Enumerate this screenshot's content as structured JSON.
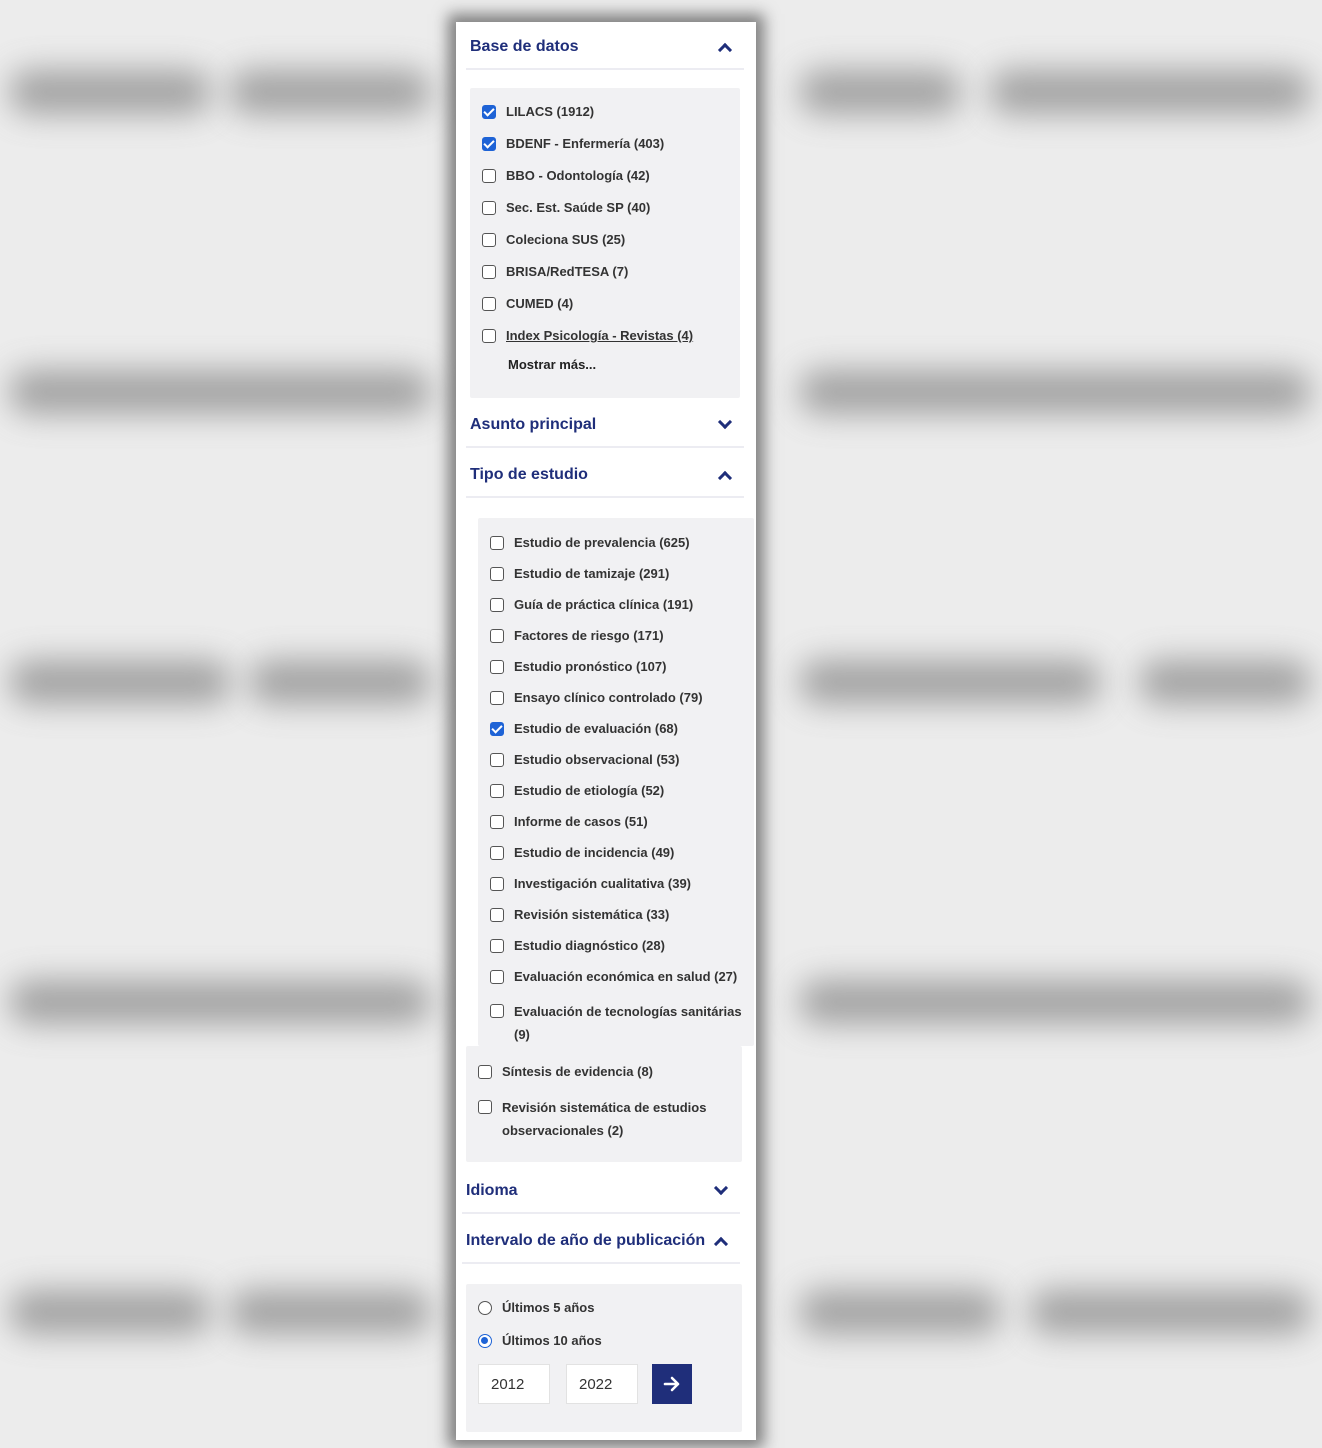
{
  "sections": {
    "base_datos": {
      "title": "Base de datos",
      "options": [
        {
          "label": "LILACS (1912)",
          "checked": true
        },
        {
          "label": "BDENF - Enfermería (403)",
          "checked": true
        },
        {
          "label": "BBO - Odontología (42)",
          "checked": false
        },
        {
          "label": "Sec. Est. Saúde SP (40)",
          "checked": false
        },
        {
          "label": "Coleciona SUS (25)",
          "checked": false
        },
        {
          "label": "BRISA/RedTESA (7)",
          "checked": false
        },
        {
          "label": "CUMED (4)",
          "checked": false
        },
        {
          "label": "Index Psicología - Revistas (4)",
          "checked": false
        }
      ],
      "show_more": "Mostrar más..."
    },
    "asunto": {
      "title": "Asunto principal"
    },
    "tipo_estudio": {
      "title": "Tipo de estudio",
      "options": [
        {
          "label": "Estudio de prevalencia (625)",
          "checked": false
        },
        {
          "label": "Estudio de tamizaje (291)",
          "checked": false
        },
        {
          "label": "Guía de práctica clínica (191)",
          "checked": false
        },
        {
          "label": "Factores de riesgo (171)",
          "checked": false
        },
        {
          "label": "Estudio pronóstico (107)",
          "checked": false
        },
        {
          "label": "Ensayo clínico controlado (79)",
          "checked": false
        },
        {
          "label": "Estudio de evaluación (68)",
          "checked": true
        },
        {
          "label": "Estudio observacional (53)",
          "checked": false
        },
        {
          "label": "Estudio de etiología (52)",
          "checked": false
        },
        {
          "label": "Informe de casos (51)",
          "checked": false
        },
        {
          "label": "Estudio de incidencia (49)",
          "checked": false
        },
        {
          "label": "Investigación cualitativa (39)",
          "checked": false
        },
        {
          "label": "Revisión sistemática (33)",
          "checked": false
        },
        {
          "label": "Estudio diagnóstico (28)",
          "checked": false
        },
        {
          "label": "Evaluación económica en salud (27)",
          "checked": false
        },
        {
          "label": "Evaluación de tecnologías sanitárias (9)",
          "checked": false
        },
        {
          "label": "Síntesis de evidencia (8)",
          "checked": false
        },
        {
          "label": "Revisión sistemática de estudios observacionales (2)",
          "checked": false
        }
      ]
    },
    "idioma": {
      "title": "Idioma"
    },
    "intervalo": {
      "title": "Intervalo de año de publicación",
      "radios": [
        {
          "label": "Últimos 5 años",
          "checked": false
        },
        {
          "label": "Últimos 10 años",
          "checked": true
        }
      ],
      "from_year": "2012",
      "to_year": "2022",
      "go_icon": "arrow-right-icon"
    }
  },
  "colors": {
    "accent": "#1f2e7a",
    "checkbox_checked": "#1e63d6",
    "box_bg": "#f1f1f3"
  }
}
